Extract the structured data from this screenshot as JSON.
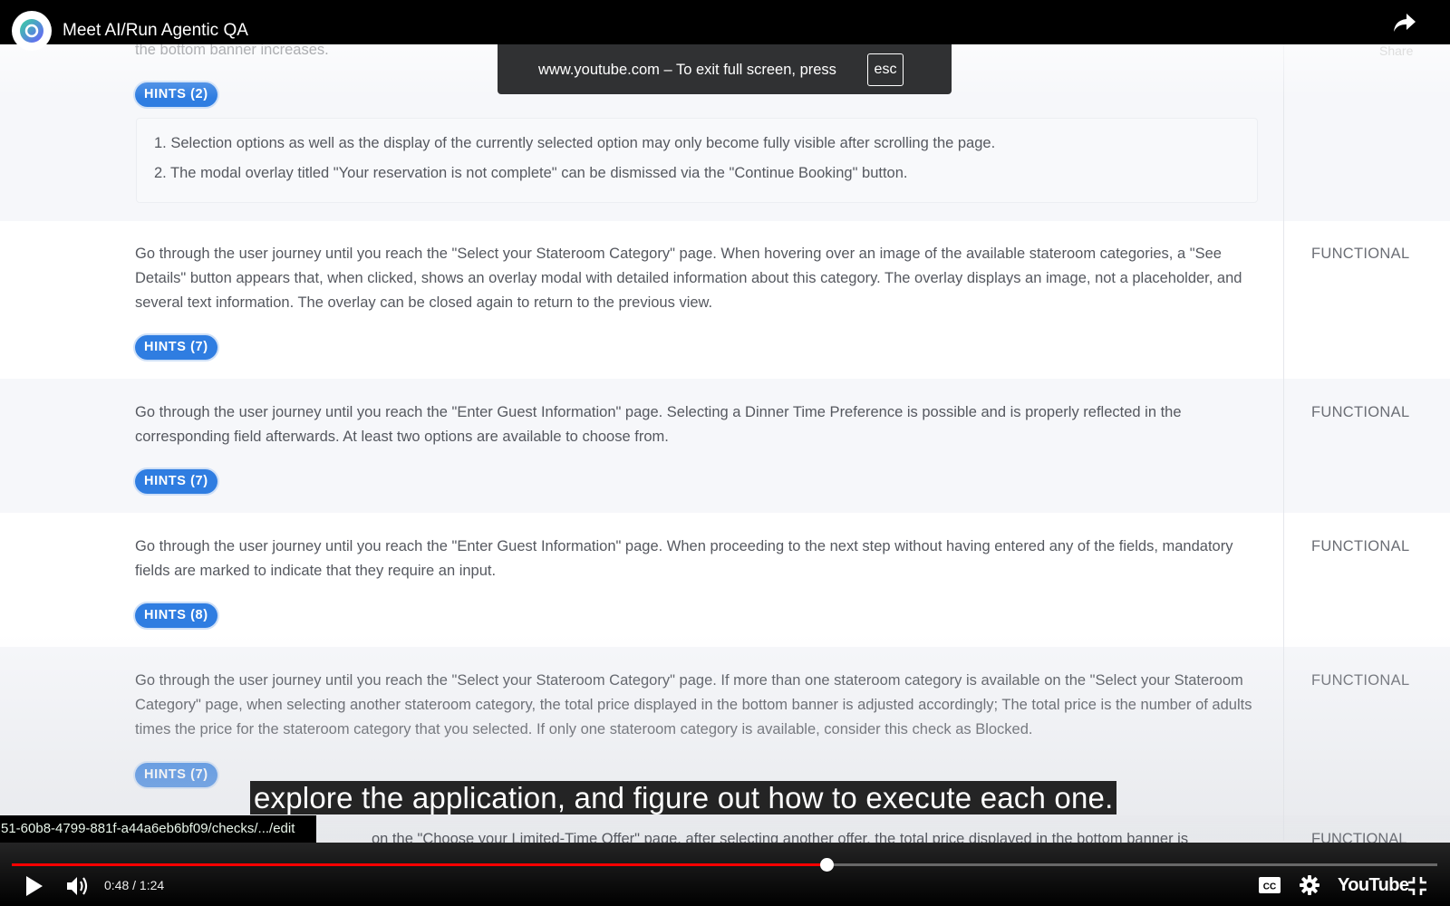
{
  "window": {
    "title": "Meet AI/Run Agentic QA",
    "share_label": "Share"
  },
  "fullscreen_toast": {
    "text": "www.youtube.com – To exit full screen, press",
    "key": "esc"
  },
  "checks": {
    "top_cut_text": "the bottom banner increases.",
    "first_hints_label": "HINTS (2)",
    "expanded_hints": [
      "1. Selection options as well as the display of the currently selected option may only become fully visible after scrolling the page.",
      "2. The modal overlay titled \"Your reservation is not complete\" can be dismissed via the \"Continue Booking\" button."
    ],
    "items": [
      {
        "description": "Go through the user journey until you reach the \"Select your Stateroom Category\" page. When hovering over an image of the available stateroom categories, a \"See Details\" button appears that, when clicked, shows an overlay modal with detailed information about this category. The overlay displays an image, not a placeholder, and several text information. The overlay can be closed again to return to the previous view.",
        "type": "FUNCTIONAL",
        "hints_label": "HINTS (7)"
      },
      {
        "description": "Go through the user journey until you reach the \"Enter Guest Information\" page. Selecting a Dinner Time Preference is possible and is properly reflected in the corresponding field afterwards. At least two options are available to choose from.",
        "type": "FUNCTIONAL",
        "hints_label": "HINTS (7)"
      },
      {
        "description": "Go through the user journey until you reach the \"Enter Guest Information\" page. When proceeding to the next step without having entered any of the fields, mandatory fields are marked to indicate that they require an input.",
        "type": "FUNCTIONAL",
        "hints_label": "HINTS (8)"
      },
      {
        "description": "Go through the user journey until you reach the \"Select your Stateroom Category\" page. If more than one stateroom category is available on the \"Select your Stateroom Category\" page, when selecting another stateroom category, the total price displayed in the bottom banner is adjusted accordingly; The total price is the number of adults times the price for the stateroom category that you selected. If only one stateroom category is available, consider this check as Blocked.",
        "type": "FUNCTIONAL",
        "hints_label": "HINTS (7)"
      }
    ],
    "bottom_cut_text": "on the \"Choose your Limited-Time Offer\" page, after selecting another offer, the total price displayed in the bottom banner is",
    "bottom_cut_type": "FUNCTIONAL"
  },
  "caption": "explore the application, and figure out how to execute each one.",
  "status_url": "51-60b8-4799-881f-a44a6eb6bf09/checks/.../edit",
  "player": {
    "current_time": "0:48",
    "duration": "1:24",
    "time_display": "0:48 / 1:24",
    "progress_fraction": 0.5714,
    "brand": "YouTube",
    "colors": {
      "progress": "#ff0000",
      "hint_badge": "#2f7de1"
    }
  }
}
